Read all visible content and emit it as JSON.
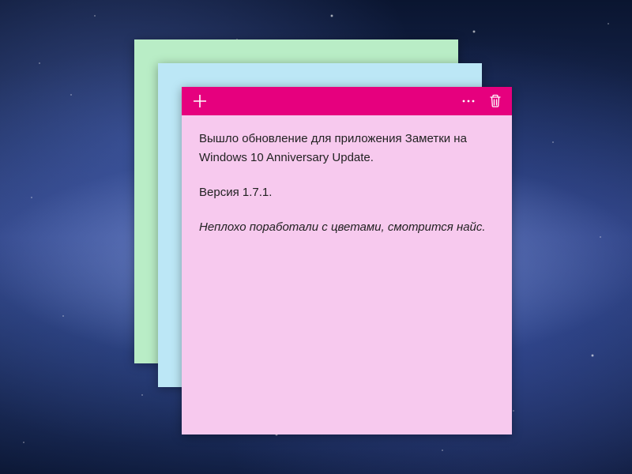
{
  "notes": {
    "green": {
      "color": "#b9edc6"
    },
    "blue": {
      "color": "#bce7f6"
    },
    "pink": {
      "color": "#f7c9ee",
      "accent": "#e6007e",
      "body": {
        "line1": "Вышло обновление для приложения Заметки на Windows 10 Anniversary Update.",
        "line2": "Версия 1.7.1.",
        "line3": "Неплохо поработали с цветами, смотрится найс."
      }
    }
  },
  "toolbar": {
    "add_label": "Add note",
    "more_label": "More",
    "delete_label": "Delete"
  }
}
